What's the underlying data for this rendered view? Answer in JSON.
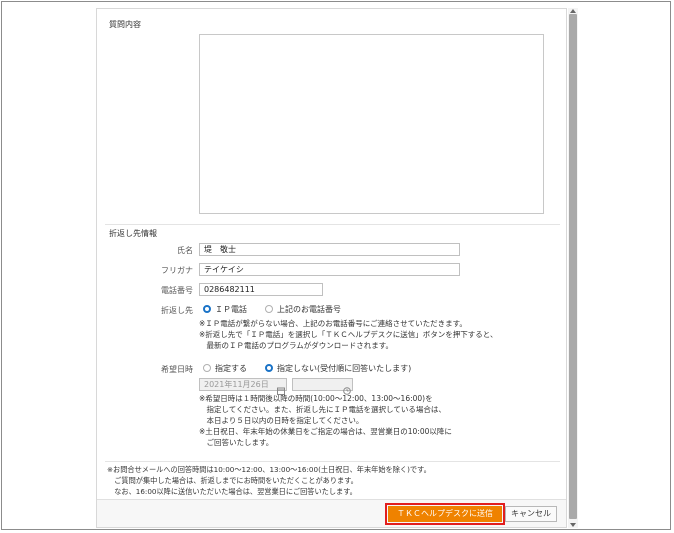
{
  "question": {
    "label": "質問内容"
  },
  "callback": {
    "section_title": "折返し先情報",
    "name_label": "氏名",
    "name_value": "堤　敬士",
    "furigana_label": "フリガナ",
    "furigana_value": "テイケイシ",
    "phone_label": "電話番号",
    "phone_value": "0286482111",
    "dest_label": "折返し先",
    "dest_options": [
      "ＩＰ電話",
      "上記のお電話番号"
    ],
    "dest_notes": [
      "※ＩＰ電話が繋がらない場合、上記のお電話番号にご連絡させていただきます。",
      "※折返し先で「ＩＰ電話」を選択し「ＴＫＣヘルプデスクに送信」ボタンを押下すると、",
      "　最新のＩＰ電話のプログラムがダウンロードされます。"
    ],
    "date_label": "希望日時",
    "date_options": [
      "指定する",
      "指定しない(受付順に回答いたします)"
    ],
    "date_value": "2021年11月26日",
    "date_notes": [
      "※希望日時は１時間後以降の時間(10:00～12:00、13:00～16:00)を",
      "　指定してください。また、折返し先にＩＰ電話を選択している場合は、",
      "　本日より５日以内の日時を指定してください。",
      "※土日祝日、年末年始の休業日をご指定の場合は、翌営業日の10:00以降に",
      "　ご回答いたします。"
    ]
  },
  "footer_notes": [
    "※お問合せメールへの回答時間は10:00～12:00、13:00～16:00(土日祝日、年末年始を除く)です。",
    "　ご質問が集中した場合は、折返しまでにお時間をいただくことがあります。",
    "　なお、16:00以降に送信いただいた場合は、翌営業日にご回答いたします。"
  ],
  "buttons": {
    "send": "ＴＫＣヘルプデスクに送信",
    "cancel": "キャンセル"
  },
  "icons": {
    "calendar": "calendar-icon",
    "clock": "clock-icon"
  },
  "colors": {
    "primary": "#ef8200",
    "highlight": "#e21e1e",
    "radio": "#1a73c7"
  }
}
